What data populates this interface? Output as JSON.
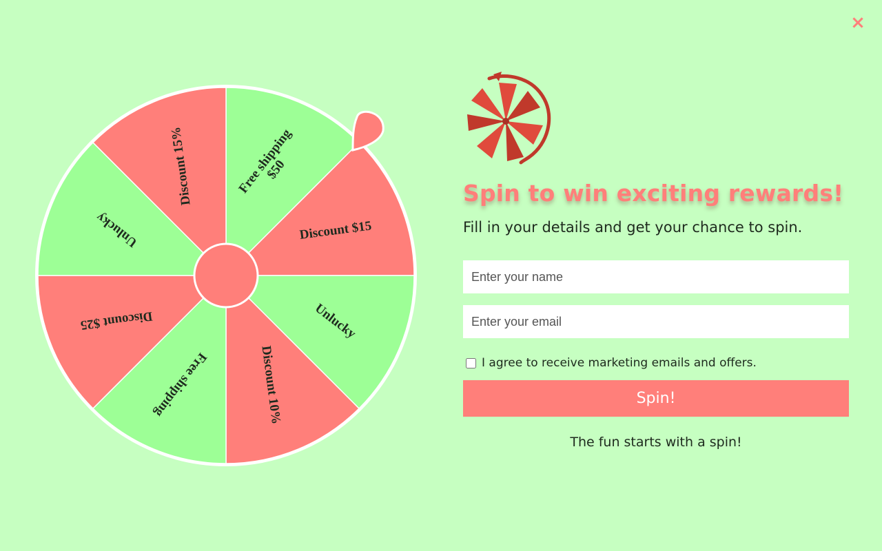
{
  "close": {
    "symbol": "×"
  },
  "wheel": {
    "colors": {
      "red": "#ff7f7a",
      "green": "#9dff96",
      "border": "#ffffff"
    },
    "segments": [
      {
        "label": "Free shipping",
        "label2": "$50",
        "color": "#9dff96"
      },
      {
        "label": "Discount $15",
        "color": "#ff7f7a"
      },
      {
        "label": "Unlucky",
        "color": "#9dff96"
      },
      {
        "label": "Discount 10%",
        "color": "#ff7f7a"
      },
      {
        "label": "Free shipping",
        "color": "#9dff96"
      },
      {
        "label": "Discount $25",
        "color": "#ff7f7a"
      },
      {
        "label": "Unlucky",
        "color": "#9dff96"
      },
      {
        "label": "Discount 15%",
        "color": "#ff7f7a"
      }
    ]
  },
  "panel": {
    "logo_icon": "spin-wheel-logo-icon",
    "headline": "Spin to win exciting rewards!",
    "subtitle": "Fill in your details and get your chance to spin.",
    "name_placeholder": "Enter your name",
    "email_placeholder": "Enter your email",
    "consent_label": "I agree to receive marketing emails and offers.",
    "spin_label": "Spin!",
    "tagline": "The fun starts with a spin!"
  },
  "theme": {
    "background": "#c6ffc1",
    "accent": "#ff7f7a",
    "logo_red": "#c0392b"
  }
}
